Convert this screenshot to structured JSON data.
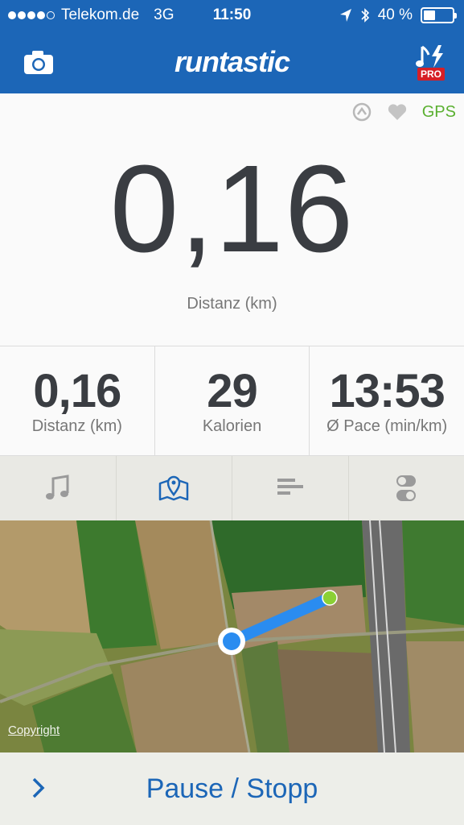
{
  "status_bar": {
    "carrier": "Telekom.de",
    "network": "3G",
    "time": "11:50",
    "battery": "40 %",
    "battery_level": 0.4
  },
  "header": {
    "logo": "runtastic",
    "pro_badge": "PRO",
    "icons": [
      "camera-icon",
      "music-pro-icon"
    ]
  },
  "main": {
    "gps_label": "GPS",
    "distance_value": "0,16",
    "distance_label": "Distanz (km)",
    "icons": [
      "route-icon",
      "heart-icon"
    ]
  },
  "stats": [
    {
      "value": "0,16",
      "label": "Distanz (km)"
    },
    {
      "value": "29",
      "label": "Kalorien"
    },
    {
      "value": "13:53",
      "label": "Ø Pace (min/km)"
    }
  ],
  "tabs": [
    {
      "icon": "music-note-icon",
      "active": false
    },
    {
      "icon": "map-icon",
      "active": true
    },
    {
      "icon": "bars-icon",
      "active": false
    },
    {
      "icon": "toggle-icon",
      "active": false
    }
  ],
  "map": {
    "copyright": "Copyright"
  },
  "bottom_bar": {
    "label": "Pause / Stopp"
  },
  "colors": {
    "brand": "#1c66b7",
    "gps": "#5ab030",
    "route": "#2a8cf0"
  }
}
